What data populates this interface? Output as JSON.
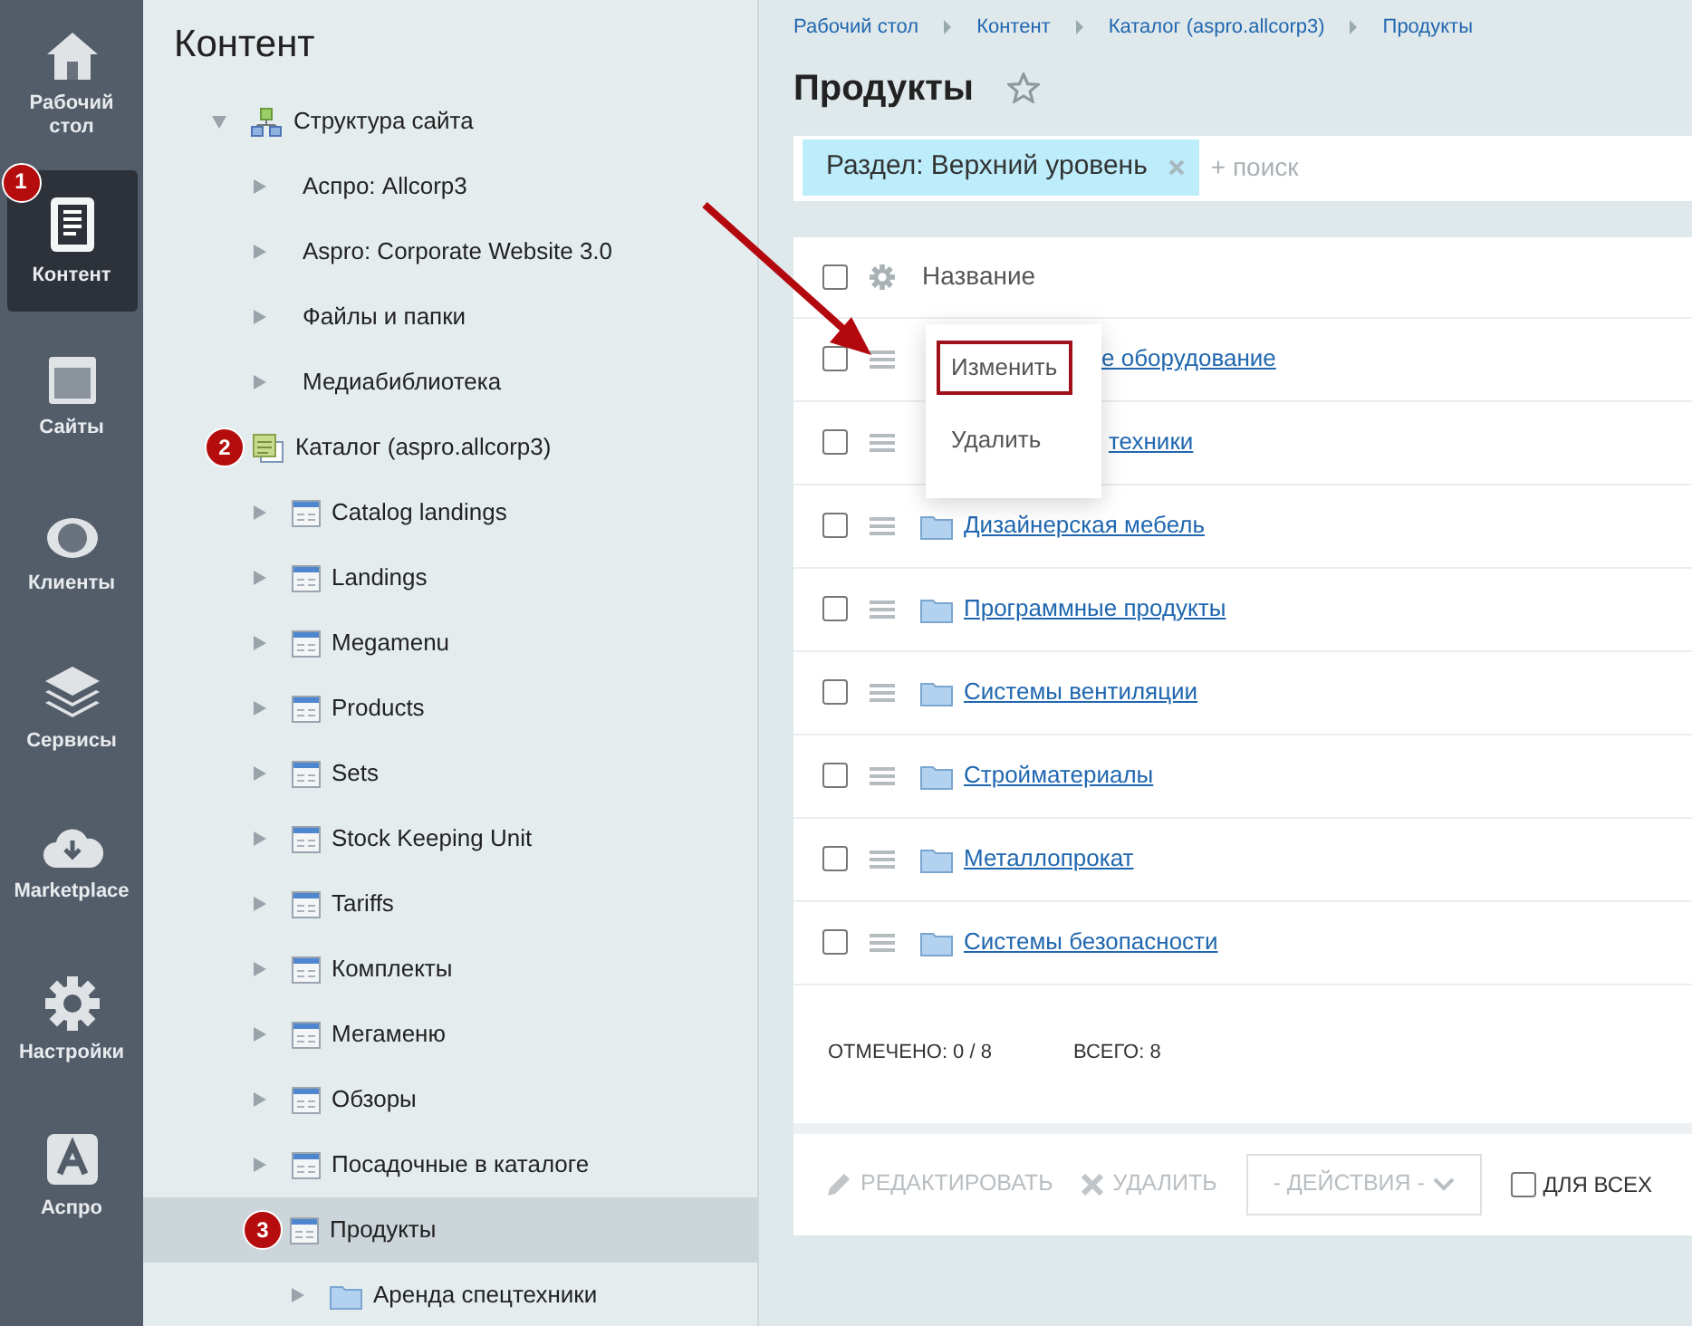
{
  "sidebar": {
    "items": [
      {
        "kind": "home",
        "label": "Рабочий стол",
        "selected": false
      },
      {
        "kind": "content",
        "label": "Контент",
        "selected": true,
        "badge": "1"
      },
      {
        "kind": "sites",
        "label": "Сайты",
        "selected": false
      },
      {
        "kind": "clients",
        "label": "Клиенты",
        "selected": false
      },
      {
        "kind": "services",
        "label": "Сервисы",
        "selected": false
      },
      {
        "kind": "market",
        "label": "Marketplace",
        "selected": false
      },
      {
        "kind": "settings",
        "label": "Настройки",
        "selected": false
      },
      {
        "kind": "aspro",
        "label": "Аспро",
        "selected": false
      }
    ]
  },
  "tree": {
    "title": "Контент",
    "items": [
      {
        "kind": "structure",
        "label": "Структура сайта",
        "expanded": true,
        "selected": false,
        "children": [
          {
            "label": "Аспро: Allcorp3",
            "expanded": false,
            "selected": false
          },
          {
            "label": "Aspro: Corporate Website 3.0",
            "expanded": false,
            "selected": false
          },
          {
            "label": "Файлы и папки",
            "expanded": false,
            "selected": false
          },
          {
            "label": "Медиабиблиотека",
            "expanded": false,
            "selected": false
          }
        ]
      },
      {
        "kind": "catalog",
        "label": "Каталог (aspro.allcorp3)",
        "expanded": true,
        "selected": false,
        "badge": "2",
        "children": [
          {
            "kind": "iblock",
            "label": "Catalog landings",
            "expanded": false,
            "selected": false
          },
          {
            "kind": "iblock",
            "label": "Landings",
            "expanded": false,
            "selected": false
          },
          {
            "kind": "iblock",
            "label": "Megamenu",
            "expanded": false,
            "selected": false
          },
          {
            "kind": "iblock",
            "label": "Products",
            "expanded": false,
            "selected": false
          },
          {
            "kind": "iblock",
            "label": "Sets",
            "expanded": false,
            "selected": false
          },
          {
            "kind": "iblock",
            "label": "Stock Keeping Unit",
            "expanded": false,
            "selected": false
          },
          {
            "kind": "iblock",
            "label": "Tariffs",
            "expanded": false,
            "selected": false
          },
          {
            "kind": "iblock",
            "label": "Комплекты",
            "expanded": false,
            "selected": false
          },
          {
            "kind": "iblock",
            "label": "Мегаменю",
            "expanded": false,
            "selected": false
          },
          {
            "kind": "iblock",
            "label": "Обзоры",
            "expanded": false,
            "selected": false
          },
          {
            "kind": "iblock",
            "label": "Посадочные в каталоге",
            "expanded": false,
            "selected": false
          },
          {
            "kind": "iblock",
            "label": "Продукты",
            "expanded": true,
            "selected": true,
            "badge": "3",
            "children": [
              {
                "kind": "folder",
                "label": "Аренда спецтехники",
                "expanded": false,
                "selected": false
              }
            ]
          }
        ]
      }
    ]
  },
  "breadcrumbs": [
    "Рабочий стол",
    "Контент",
    "Каталог (aspro.allcorp3)",
    "Продукты"
  ],
  "page_title": "Продукты",
  "filter": {
    "tag": "Раздел: Верхний уровень",
    "placeholder": "+ поиск"
  },
  "table": {
    "columns": [
      "Название"
    ],
    "all_checked": false,
    "rows": [
      {
        "name": "е оборудование",
        "covered": true,
        "checked": false
      },
      {
        "name": "техники",
        "covered": true,
        "checked": false
      },
      {
        "name": "Дизайнерская мебель",
        "covered": false,
        "checked": false
      },
      {
        "name": "Программные продукты",
        "covered": false,
        "checked": false
      },
      {
        "name": "Системы вентиляции",
        "covered": false,
        "checked": false
      },
      {
        "name": "Стройматериалы",
        "covered": false,
        "checked": false
      },
      {
        "name": "Металлопрокат",
        "covered": false,
        "checked": false
      },
      {
        "name": "Системы безопасности",
        "covered": false,
        "checked": false
      }
    ],
    "selected_count": "ОТМЕЧЕНО: 0 / 8",
    "total": "ВСЕГО: 8"
  },
  "actions": {
    "edit": "РЕДАКТИРОВАТЬ",
    "delete": "УДАЛИТЬ",
    "select": "- ДЕЙСТВИЯ -",
    "for_all": "ДЛЯ ВСЕХ",
    "for_all_checked": false
  },
  "context_menu": {
    "items": [
      {
        "label": "Изменить",
        "highlighted": true
      },
      {
        "label": "Удалить",
        "highlighted": false
      }
    ]
  }
}
